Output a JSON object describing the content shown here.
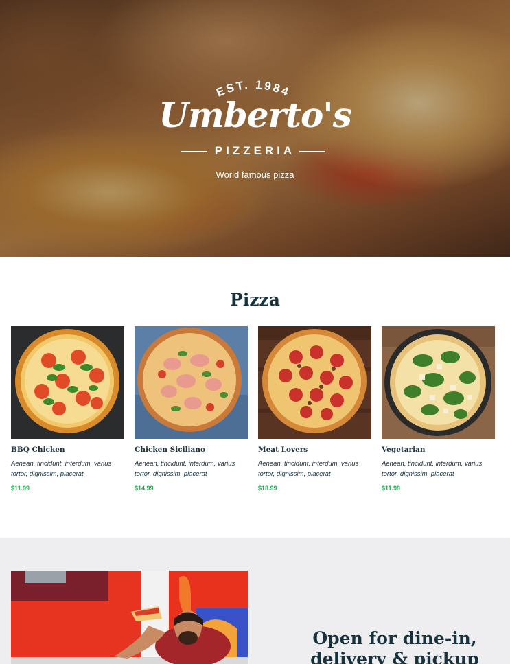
{
  "hero": {
    "established": "EST. 1984",
    "brand_name": "Umberto's",
    "brand_type": "PIZZERIA",
    "tagline": "World famous pizza"
  },
  "menu": {
    "title": "Pizza",
    "items": [
      {
        "name": "BBQ Chicken",
        "description": "Aenean, tincidunt, interdum, varius tortor, dignissim, placerat",
        "price": "$11.99"
      },
      {
        "name": "Chicken Siciliano",
        "description": "Aenean, tincidunt, interdum, varius tortor, dignissim, placerat",
        "price": "$14.99"
      },
      {
        "name": "Meat Lovers",
        "description": "Aenean, tincidunt, interdum, varius tortor, dignissim, placerat",
        "price": "$18.99"
      },
      {
        "name": "Vegetarian",
        "description": "Aenean, tincidunt, interdum, varius tortor, dignissim, placerat",
        "price": "$11.99"
      }
    ]
  },
  "promo": {
    "heading": "Open for dine-in, delivery & pickup"
  },
  "colors": {
    "heading": "#17323c",
    "price": "#21a84f",
    "promo_background": "#eeeef1"
  }
}
